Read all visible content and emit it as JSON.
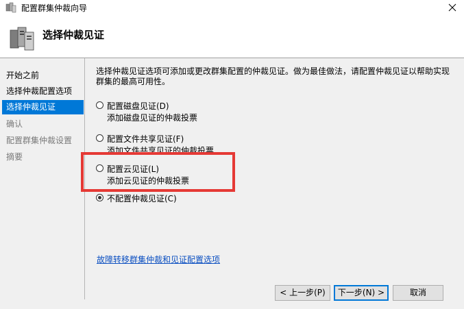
{
  "window": {
    "title": "配置群集仲裁向导",
    "close_glyph": "✕"
  },
  "header": {
    "title": "选择仲裁见证"
  },
  "nav": {
    "items": [
      {
        "label": "开始之前",
        "state": "normal"
      },
      {
        "label": "选择仲裁配置选项",
        "state": "normal"
      },
      {
        "label": "选择仲裁见证",
        "state": "selected"
      },
      {
        "label": "确认",
        "state": "disabled"
      },
      {
        "label": "配置群集仲裁设置",
        "state": "disabled"
      },
      {
        "label": "摘要",
        "state": "disabled"
      }
    ]
  },
  "main": {
    "description": "选择仲裁见证选项可添加或更改群集配置的仲裁见证。做为最佳做法，请配置仲裁见证以帮助实现群集的最高可用性。",
    "options": [
      {
        "label": "配置磁盘见证(D)",
        "desc": "添加磁盘见证的仲裁投票",
        "checked": false
      },
      {
        "label": "配置文件共享见证(F)",
        "desc": "添加文件共享见证的仲裁投票",
        "checked": false
      },
      {
        "label": "配置云见证(L)",
        "desc": "添加云见证的仲裁投票",
        "checked": false
      },
      {
        "label": "不配置仲裁见证(C)",
        "desc": "",
        "checked": true
      }
    ],
    "link": "故障转移群集仲裁和见证配置选项"
  },
  "buttons": {
    "prev": "< 上一步(P)",
    "next": "下一步(N) >",
    "cancel": "取消"
  },
  "colors": {
    "selected_nav": "#0078d7",
    "highlight_box": "#e53935",
    "link": "#0b4fc1"
  }
}
